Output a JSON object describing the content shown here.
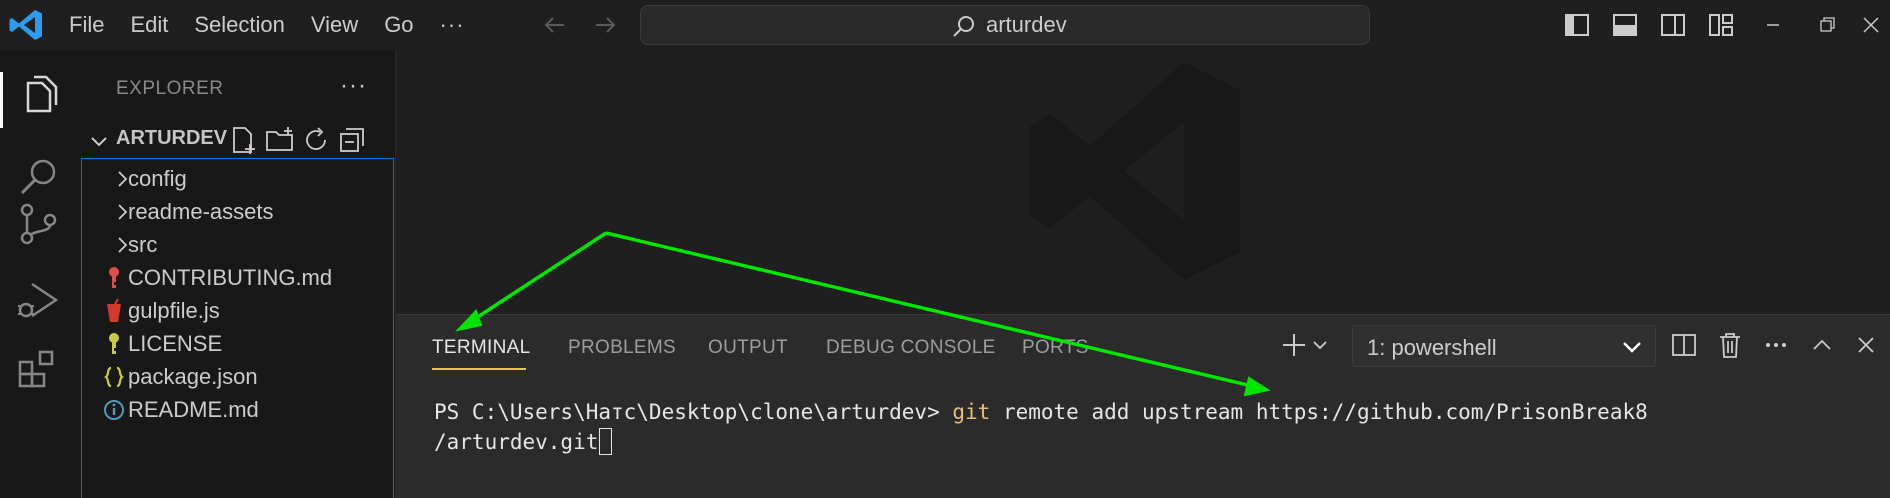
{
  "titlebar": {
    "app_icon": "vscode-logo",
    "menu": [
      "File",
      "Edit",
      "Selection",
      "View",
      "Go"
    ],
    "menu_more": "···",
    "search_text": "arturdev",
    "icons": {
      "back": "arrow-left-icon",
      "forward": "arrow-right-icon",
      "search": "search-icon",
      "layout": [
        "toggle-primary-sidebar-icon",
        "toggle-panel-icon",
        "toggle-secondary-sidebar-icon",
        "customize-layout-icon"
      ],
      "window": [
        "minimize-icon",
        "restore-icon",
        "close-icon"
      ]
    }
  },
  "activitybar": {
    "items": [
      "explorer-icon",
      "search-icon",
      "source-control-icon",
      "run-debug-icon",
      "extensions-icon"
    ],
    "active": "explorer-icon"
  },
  "sidebar": {
    "title": "EXPLORER",
    "more": "···",
    "folder": {
      "name": "ARTURDEV",
      "actions": [
        "new-file-icon",
        "new-folder-icon",
        "refresh-icon",
        "collapse-all-icon"
      ]
    },
    "items": [
      {
        "label": "config",
        "type": "folder"
      },
      {
        "label": "readme-assets",
        "type": "folder"
      },
      {
        "label": "src",
        "type": "folder"
      },
      {
        "label": "CONTRIBUTING.md",
        "type": "file",
        "icon": "contributing-key-icon",
        "color": "#e04c4c"
      },
      {
        "label": "gulpfile.js",
        "type": "file",
        "icon": "gulp-icon",
        "color": "#d33a2c"
      },
      {
        "label": "LICENSE",
        "type": "file",
        "icon": "license-key-icon",
        "color": "#cbcb41"
      },
      {
        "label": "package.json",
        "type": "file",
        "icon": "json-braces-icon",
        "color": "#cbcb41"
      },
      {
        "label": "README.md",
        "type": "file",
        "icon": "info-icon",
        "color": "#519aba"
      }
    ]
  },
  "panel": {
    "tabs": [
      "TERMINAL",
      "PROBLEMS",
      "OUTPUT",
      "DEBUG CONSOLE",
      "PORTS"
    ],
    "active_tab": "TERMINAL",
    "terminal_select": "1: powershell",
    "controls": [
      "new-terminal-icon",
      "launch-profile-chevron-icon",
      "split-terminal-icon",
      "kill-terminal-icon",
      "more-actions-icon",
      "maximize-panel-icon",
      "close-panel-icon"
    ],
    "terminal": {
      "prompt": "PS C:\\Users\\Hатс\\Desktop\\clone\\arturdev> ",
      "command": "git",
      "args": " remote add upstream https://github.com/PrisonBreak8",
      "line2": "/arturdev.git"
    }
  },
  "colors": {
    "accent_blue": "#0078d4",
    "active_tab_underline": "#e7c547",
    "annotation_arrow": "#00e600"
  }
}
